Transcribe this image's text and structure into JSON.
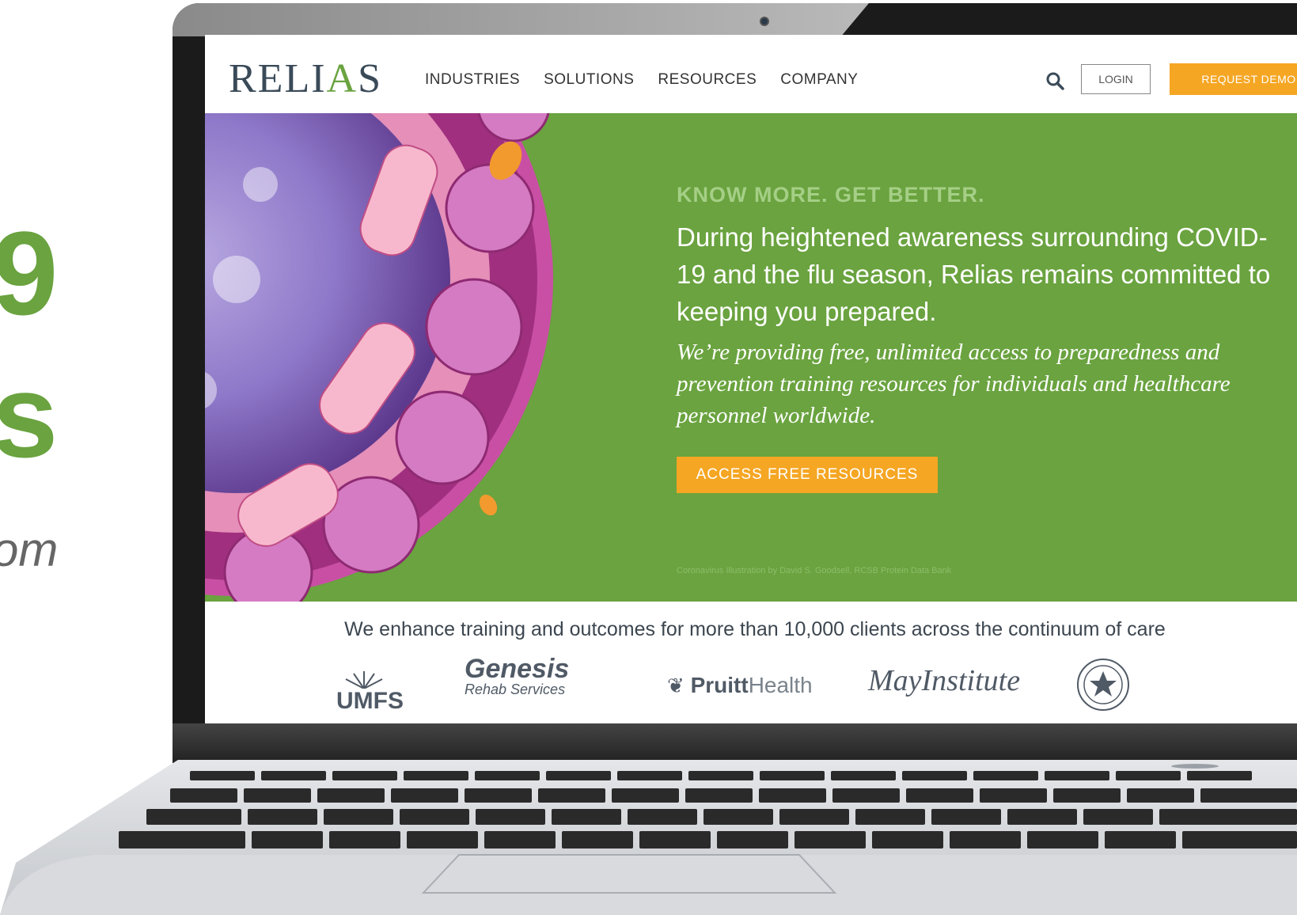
{
  "caption": {
    "big_line_1": "9",
    "big_line_2": "s",
    "italic": "om"
  },
  "nav": {
    "logo": "RELIAS",
    "menu": [
      "INDUSTRIES",
      "SOLUTIONS",
      "RESOURCES",
      "COMPANY"
    ],
    "login_label": "LOGIN",
    "demo_label": "REQUEST DEMO",
    "search_icon": "search-icon"
  },
  "hero": {
    "eyebrow": "KNOW MORE. GET BETTER.",
    "headline": "During heightened awareness surrounding COVID-19 and the flu season, Relias remains committed to keeping you prepared.",
    "subtext": "We’re providing free, unlimited access to preparedness and prevention training resources for individuals and healthcare personnel worldwide.",
    "cta_label": "ACCESS FREE RESOURCES",
    "credit": "Coronavirus Illustration by David S. Goodsell, RCSB Protein Data Bank"
  },
  "clients": {
    "tagline": "We enhance training and outcomes for more than 10,000 clients across the continuum of care",
    "logos": [
      "UMFS",
      "Genesis",
      "Rehab Services",
      "Pruitt",
      "Health",
      "MayInstitute"
    ]
  },
  "colors": {
    "brand_green": "#6aa33f",
    "accent_orange": "#f5a623",
    "text_dark": "#3c4650"
  }
}
